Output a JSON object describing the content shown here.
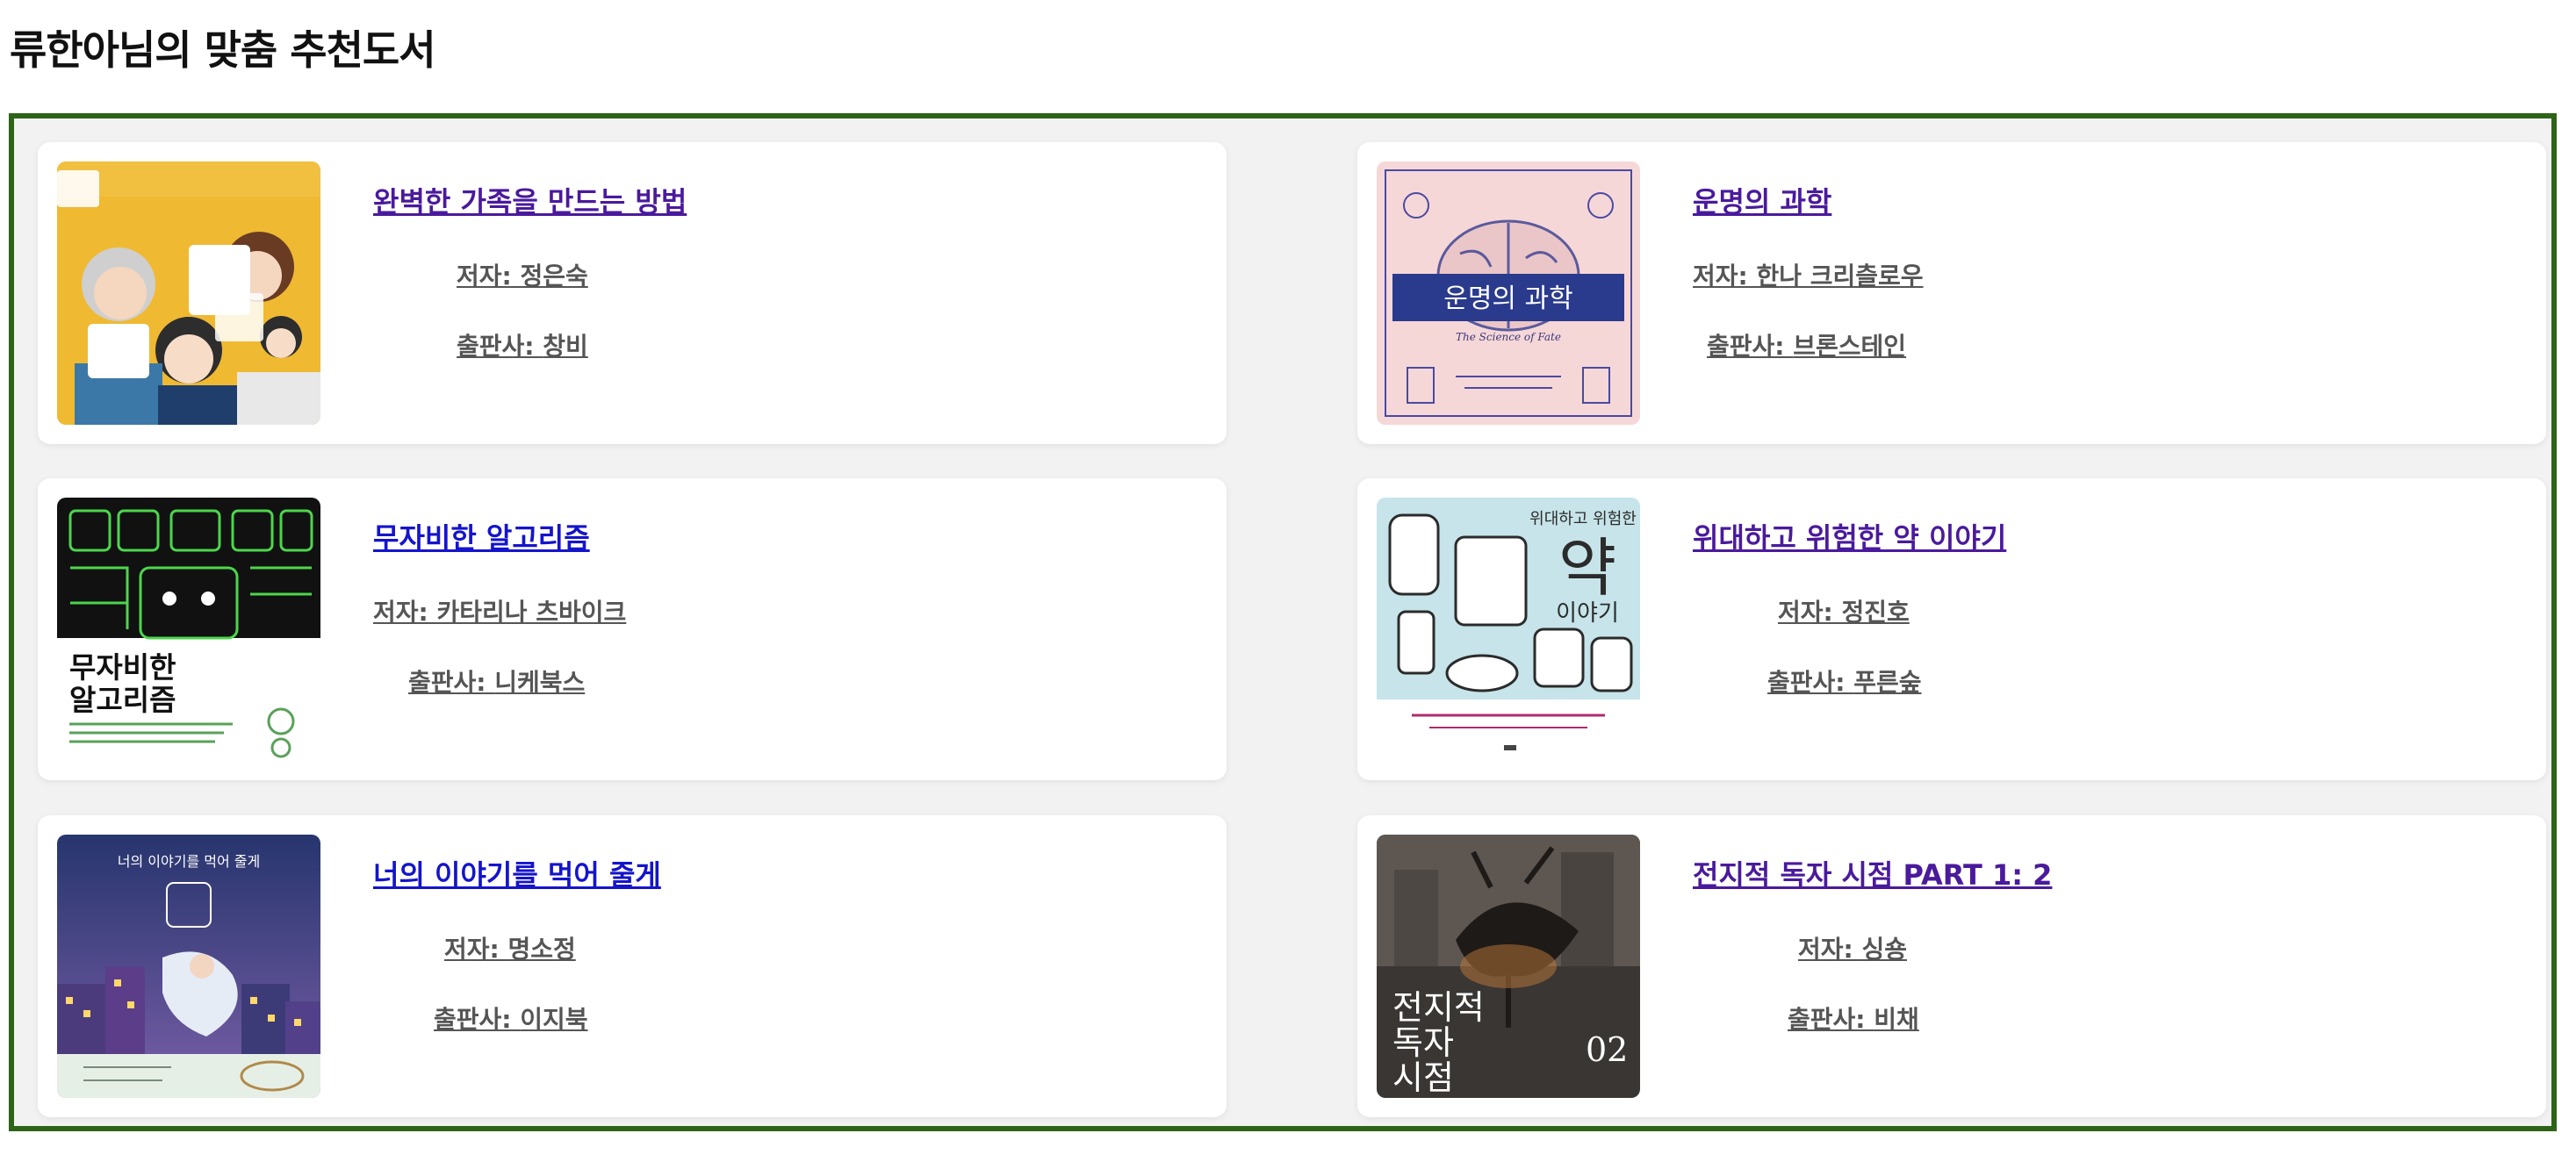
{
  "page": {
    "title": "류한아님의 맞춤 추천도서"
  },
  "colors": {
    "frame_border": "#2e6318",
    "visited_link": "#4a1a9c",
    "unvisited_link": "#1414cc",
    "meta_text": "#555555"
  },
  "labels": {
    "author": "저자: ",
    "publisher": "출판사: "
  },
  "books": [
    {
      "title": "완벽한 가족을 만드는 방법",
      "author": "정은숙",
      "publisher": "창비",
      "link_state": "visited",
      "cover_icon": "book-cover-illustrated-family"
    },
    {
      "title": "운명의 과학",
      "author": "한나 크리츨로우",
      "publisher": "브론스테인",
      "link_state": "visited",
      "cover_icon": "book-cover-brain",
      "cover_text": {
        "main": "운명의 과학",
        "sub": "The Science of Fate"
      }
    },
    {
      "title": "무자비한 알고리즘",
      "author": "카타리나 츠바이크",
      "publisher": "니케북스",
      "link_state": "unvisited",
      "cover_icon": "book-cover-circuit-robot",
      "cover_text": {
        "main_line1": "무자비한",
        "main_line2": "알고리즘"
      }
    },
    {
      "title": "위대하고 위험한 약 이야기",
      "author": "정진호",
      "publisher": "푸른숲",
      "link_state": "visited",
      "cover_icon": "book-cover-medicine-bottles",
      "cover_text": {
        "top": "위대하고 위험한",
        "big": "약",
        "small": "이야기"
      }
    },
    {
      "title": "너의 이야기를 먹어 줄게",
      "author": "명소정",
      "publisher": "이지북",
      "link_state": "unvisited",
      "cover_icon": "book-cover-night-city",
      "cover_text": {
        "top": "너의 이야기를 먹어 줄게"
      }
    },
    {
      "title": "전지적 독자 시점 PART 1: 2",
      "author": "싱숑",
      "publisher": "비채",
      "link_state": "visited",
      "cover_icon": "book-cover-dark-fantasy",
      "cover_text": {
        "line1": "전지적",
        "line2": "독자",
        "line3": "시점",
        "volume": "02"
      }
    }
  ]
}
